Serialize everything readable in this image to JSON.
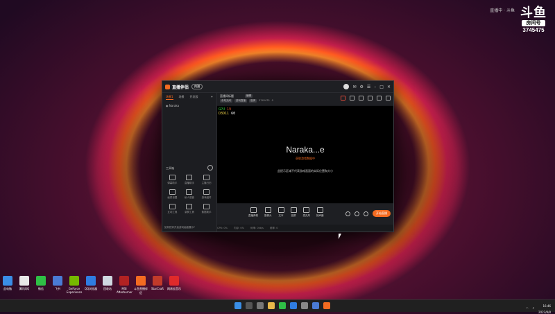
{
  "watermark": {
    "top_text": "直播中 · 斗鱼",
    "logo": "斗鱼",
    "sub": "房间号",
    "room_number": "3745475"
  },
  "app": {
    "brand": "直播伴侣",
    "version": "内测",
    "sidebar_tabs": [
      "场景1",
      "场景",
      "开发版"
    ],
    "scene_item": "Naraka",
    "tools_title": "工具箱",
    "tools": [
      "弹幕助手",
      "直播助手",
      "主播日历",
      "画质设置",
      "私人语音",
      "游戏组件",
      "互动工具",
      "录屏工具",
      "数据助手"
    ],
    "notice": "如何把你开启游戏画面展示?"
  },
  "room": {
    "title": "直播间标题",
    "edit_label": "编辑",
    "tags": [
      "永劫无间",
      "游戏直播",
      "高清"
    ],
    "room_number_label": "3745475",
    "online": "0"
  },
  "preview": {
    "gpu_line1_label": "GPU",
    "gpu_line1_value": "19",
    "gpu_line2_label": "D3D11",
    "gpu_line2_value": "60",
    "title": "Naraka...e",
    "status": "获取游戏数据中",
    "hint": "此提示区域不代表游戏画面的实际位置和大小"
  },
  "bottom": {
    "tools": [
      "直播弹幕",
      "摄像头",
      "文本",
      "投屏",
      "麦克风",
      "扬声器"
    ],
    "live_button": "开始直播",
    "status_items": [
      "CPU: 0%",
      "内存: 0%",
      "码率: 0kb/s",
      "帧率: 0"
    ]
  },
  "desktop_icons": [
    {
      "label": "此电脑",
      "color": "#3a8ee6"
    },
    {
      "label": "腾讯QQ",
      "color": "#e8e8e8"
    },
    {
      "label": "微信",
      "color": "#2fbf46"
    },
    {
      "label": "飞书",
      "color": "#4a7bd4"
    },
    {
      "label": "GeForce Experience",
      "color": "#76b900"
    },
    {
      "label": "QQ浏览器",
      "color": "#2f7de1"
    },
    {
      "label": "回收站",
      "color": "#cfd8e0"
    },
    {
      "label": "MSI Afterburner",
      "color": "#b22222"
    },
    {
      "label": "斗鱼直播伴侣",
      "color": "#f36b21"
    },
    {
      "label": "StarCraft",
      "color": "#c23a2a"
    },
    {
      "label": "网易云音乐",
      "color": "#e02a2a"
    }
  ],
  "taskbar": {
    "time": "16:46",
    "date": "2023/8/8"
  }
}
